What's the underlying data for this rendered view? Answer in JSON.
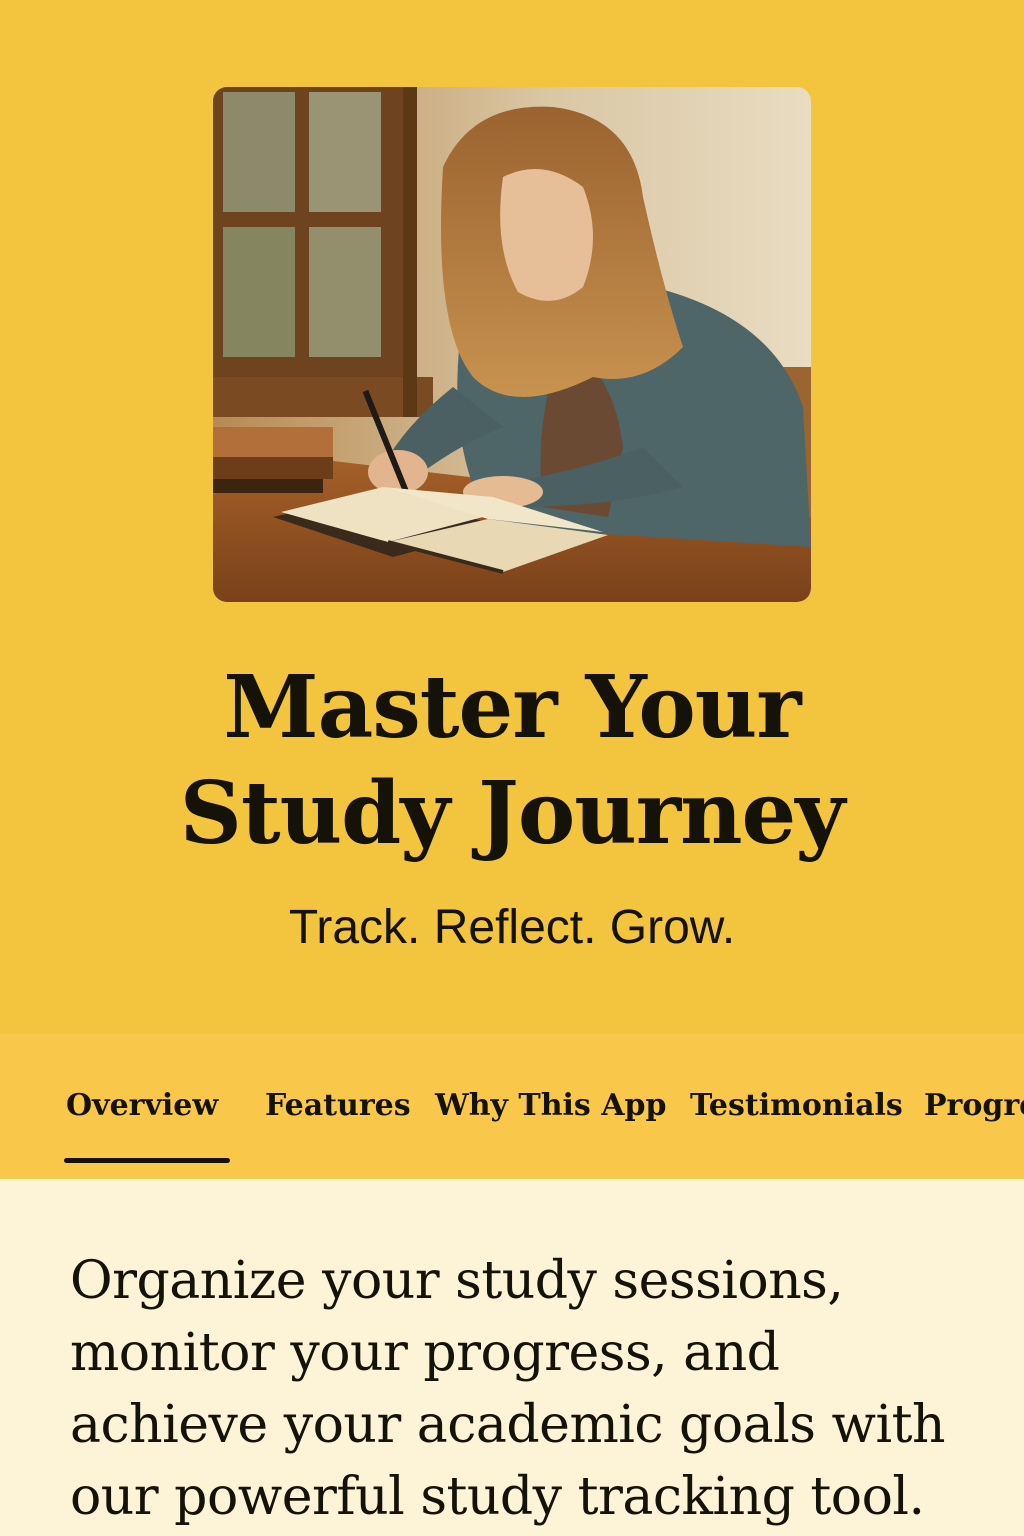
{
  "hero": {
    "image_alt": "woman-studying-photo",
    "title_line1": "Master Your",
    "title_line2": "Study Journey",
    "subtitle": "Track. Reflect. Grow."
  },
  "tabs": [
    {
      "label": "Overview",
      "active": true
    },
    {
      "label": "Features",
      "active": false
    },
    {
      "label": "Why This App",
      "active": false
    },
    {
      "label": "Testimonials",
      "active": false
    },
    {
      "label": "Progre",
      "active": false
    }
  ],
  "content": {
    "intro": "Organize your study sessions, monitor your progress, and achieve your academic goals with our powerful study tracking tool."
  },
  "colors": {
    "hero_bg": "#f3c53f",
    "tabs_bg": "#f9c84a",
    "content_bg": "#fdf3d6",
    "text": "#141209"
  }
}
